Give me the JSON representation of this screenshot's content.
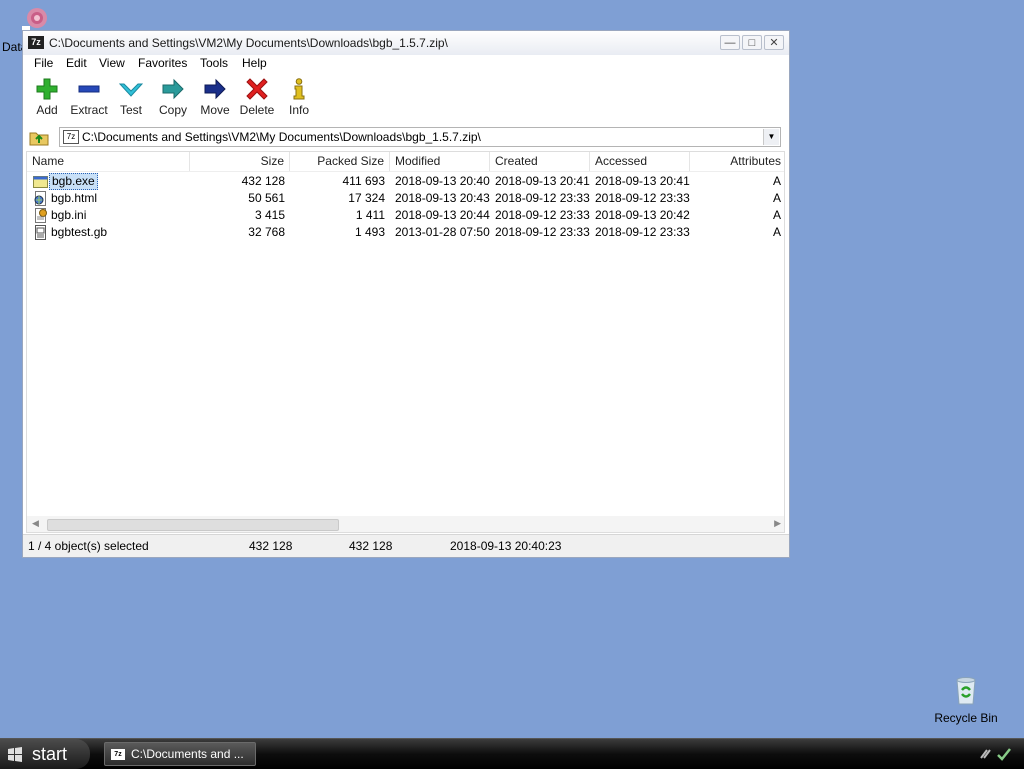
{
  "desktop": {
    "data_icon_label": "Data",
    "recycle_bin_label": "Recycle Bin"
  },
  "window": {
    "title": "C:\\Documents and Settings\\VM2\\My Documents\\Downloads\\bgb_1.5.7.zip\\",
    "app_icon_text": "7z"
  },
  "menu": [
    "File",
    "Edit",
    "View",
    "Favorites",
    "Tools",
    "Help"
  ],
  "toolbar": {
    "add": "Add",
    "extract": "Extract",
    "test": "Test",
    "copy": "Copy",
    "move": "Move",
    "delete": "Delete",
    "info": "Info"
  },
  "address": {
    "path": "C:\\Documents and Settings\\VM2\\My Documents\\Downloads\\bgb_1.5.7.zip\\"
  },
  "columns": {
    "name": "Name",
    "size": "Size",
    "packed": "Packed Size",
    "modified": "Modified",
    "created": "Created",
    "accessed": "Accessed",
    "attributes": "Attributes"
  },
  "files": [
    {
      "name": "bgb.exe",
      "size": "432 128",
      "packed": "411 693",
      "modified": "2018-09-13 20:40",
      "created": "2018-09-13 20:41",
      "accessed": "2018-09-13 20:41",
      "attributes": "A",
      "icon": "exe-file-icon"
    },
    {
      "name": "bgb.html",
      "size": "50 561",
      "packed": "17 324",
      "modified": "2018-09-13 20:43",
      "created": "2018-09-12 23:33",
      "accessed": "2018-09-12 23:33",
      "attributes": "A",
      "icon": "html-file-icon"
    },
    {
      "name": "bgb.ini",
      "size": "3 415",
      "packed": "1 411",
      "modified": "2018-09-13 20:44",
      "created": "2018-09-12 23:33",
      "accessed": "2018-09-13 20:42",
      "attributes": "A",
      "icon": "ini-file-icon"
    },
    {
      "name": "bgbtest.gb",
      "size": "32 768",
      "packed": "1 493",
      "modified": "2013-01-28 07:50",
      "created": "2018-09-12 23:33",
      "accessed": "2018-09-12 23:33",
      "attributes": "A",
      "icon": "gb-file-icon"
    }
  ],
  "status": {
    "selected": "1 / 4 object(s) selected",
    "size": "432 128",
    "packed": "432 128",
    "datetime": "2018-09-13 20:40:23"
  },
  "taskbar": {
    "start_label": "start",
    "task_label": "C:\\Documents and ..."
  },
  "colors": {
    "desktop": "#7f9fd4",
    "selection": "#c8e0f7",
    "add_green": "#2fb02f",
    "delete_red": "#e02020"
  }
}
